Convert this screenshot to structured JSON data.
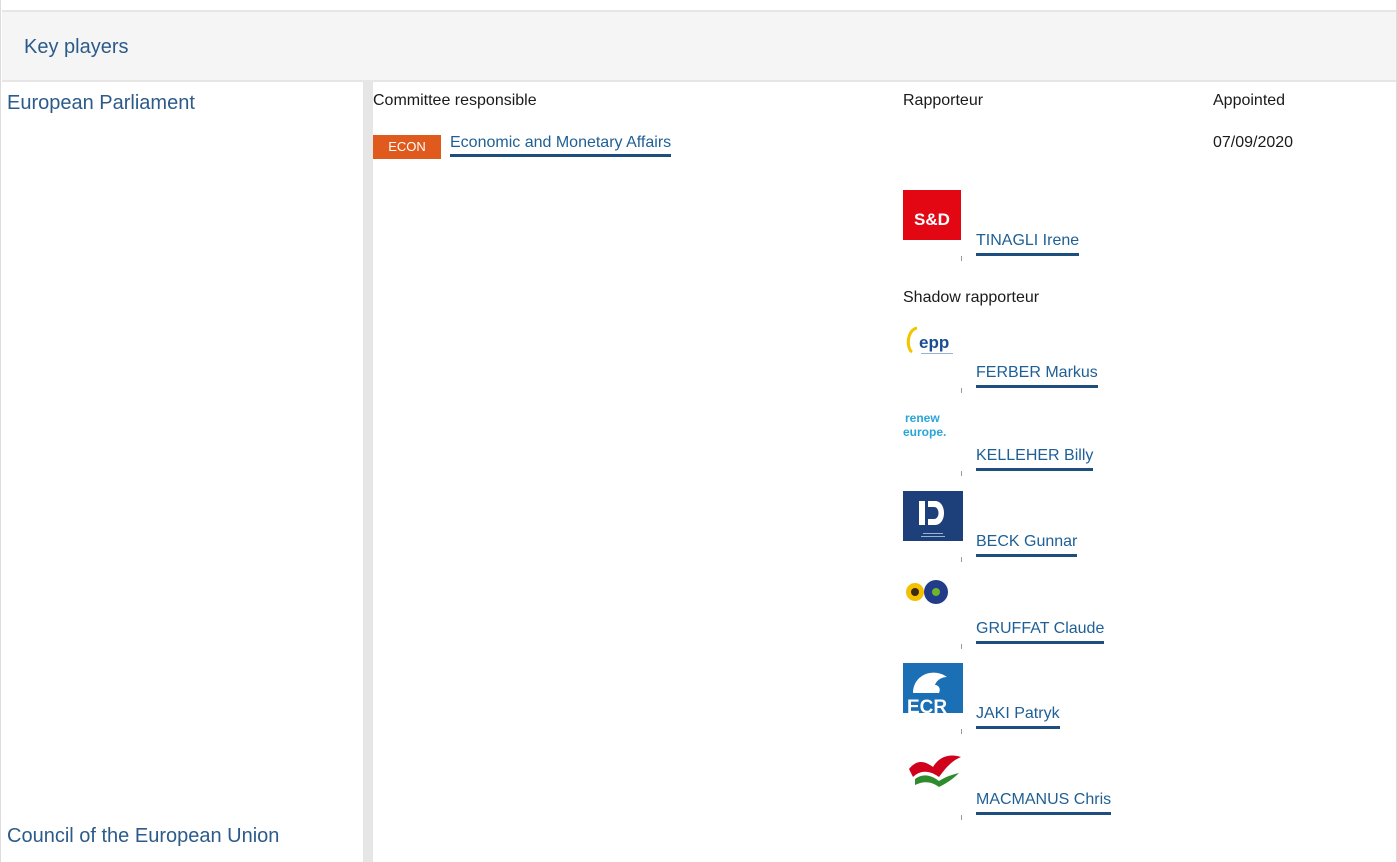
{
  "section": {
    "title": "Key players"
  },
  "institutions": {
    "parliament": "European Parliament",
    "council": "Council of the European Union"
  },
  "columns": {
    "committee": "Committee responsible",
    "rapporteur": "Rapporteur",
    "appointed": "Appointed"
  },
  "committee": {
    "abbr": "ECON",
    "name": "Economic and Monetary Affairs",
    "appointed": "07/09/2020",
    "badge_color": "#e05a1e"
  },
  "rapporteur": {
    "group_logo": "s-and-d-logo",
    "name": "TINAGLI Irene"
  },
  "shadow_label": "Shadow rapporteur",
  "shadows": [
    {
      "group_logo": "epp-logo",
      "name": "FERBER Markus"
    },
    {
      "group_logo": "renew-europe-logo",
      "name": "KELLEHER Billy"
    },
    {
      "group_logo": "id-logo",
      "name": "BECK Gunnar"
    },
    {
      "group_logo": "greens-efa-logo",
      "name": "GRUFFAT Claude"
    },
    {
      "group_logo": "ecr-logo",
      "name": "JAKI Patryk"
    },
    {
      "group_logo": "the-left-logo",
      "name": "MACMANUS Chris"
    }
  ],
  "logo_text": {
    "sd": "S&D",
    "epp": "epp",
    "renew1": "renew",
    "renew2": "europe.",
    "ecr": "ECR"
  },
  "colors": {
    "link": "#1e5f96",
    "heading": "#2c5b8a",
    "header_bg": "#f5f5f5"
  }
}
